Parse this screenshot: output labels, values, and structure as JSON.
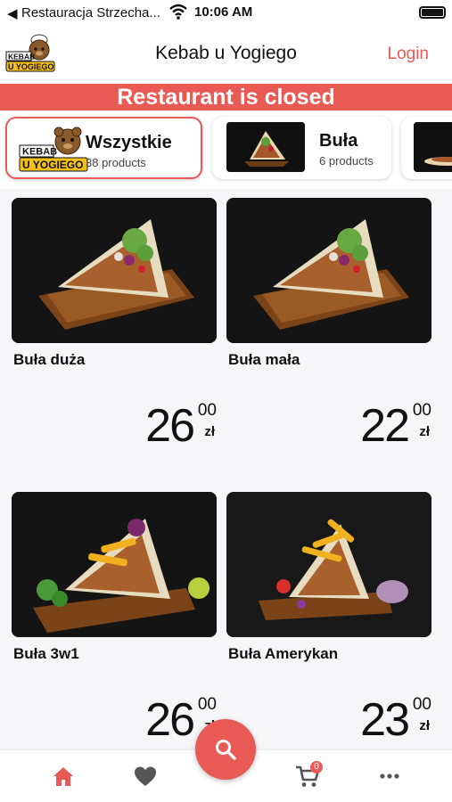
{
  "statusbar": {
    "back_glyph": "◀",
    "carrier": "Restauracja Strzecha...",
    "time": "10:06 AM",
    "icons": [
      "wifi-icon",
      "battery-icon"
    ]
  },
  "header": {
    "title": "Kebab u Yogiego",
    "login": "Login",
    "logo_text": "KEBAB U YOGIEGO"
  },
  "banner": {
    "text": "Restaurant is closed"
  },
  "categories": [
    {
      "name": "Wszystkie",
      "count": "38 products",
      "active": true
    },
    {
      "name": "Buła",
      "count": "6 products",
      "active": false
    }
  ],
  "products": [
    {
      "name": "Buła duża",
      "price_major": "26",
      "price_minor": "00",
      "currency": "zł"
    },
    {
      "name": "Buła mała",
      "price_major": "22",
      "price_minor": "00",
      "currency": "zł"
    },
    {
      "name": "Buła 3w1",
      "price_major": "26",
      "price_minor": "00",
      "currency": "zł"
    },
    {
      "name": "Buła Amerykan",
      "price_major": "23",
      "price_minor": "00",
      "currency": "zł"
    }
  ],
  "tabbar": {
    "items": [
      "home-icon",
      "heart-icon",
      "cart-icon",
      "more-icon"
    ],
    "cart_badge": "0",
    "fab_icon": "search-icon"
  },
  "colors": {
    "accent": "#e95a55",
    "text": "#111111",
    "background": "#f6f6f8"
  }
}
